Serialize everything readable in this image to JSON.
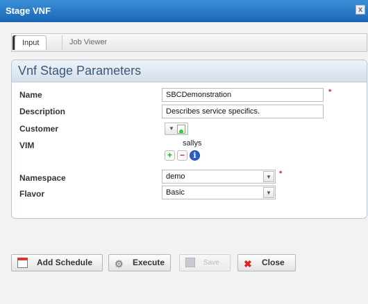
{
  "window": {
    "title": "Stage VNF",
    "close_glyph": "x"
  },
  "tabs": [
    {
      "label": "Input",
      "active": true
    },
    {
      "label": "Job Viewer",
      "active": false
    }
  ],
  "panel": {
    "title": "Vnf Stage Parameters"
  },
  "form": {
    "name": {
      "label": "Name",
      "value": "SBCDemonstration",
      "required": true
    },
    "description": {
      "label": "Description",
      "value": "Describes service specifics."
    },
    "customer": {
      "label": "Customer"
    },
    "vim": {
      "label": "VIM",
      "value": "sallys"
    },
    "namespace": {
      "label": "Namespace",
      "value": "demo",
      "required": true
    },
    "flavor": {
      "label": "Flavor",
      "value": "Basic"
    }
  },
  "buttons": {
    "add_schedule": "Add Schedule",
    "execute": "Execute",
    "save": "Save",
    "close": "Close"
  },
  "glyphs": {
    "required_marker": "*",
    "add": "+",
    "remove": "−",
    "info": "i",
    "dropdown": "▼",
    "close_x": "✖",
    "gear": "⚙"
  },
  "colors": {
    "titlebar": "#1a66b4",
    "panel_title": "#3b5977",
    "required": "#dd2222"
  }
}
